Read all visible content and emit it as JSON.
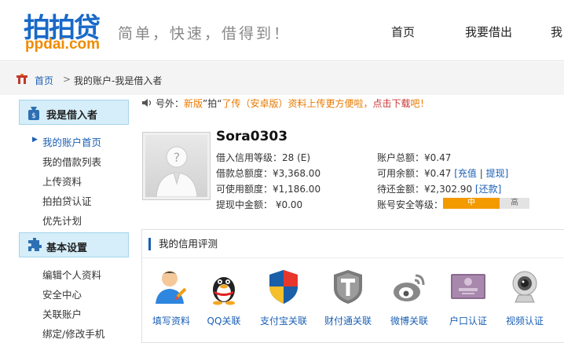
{
  "header": {
    "logo_cn": "拍拍贷",
    "logo_en": "ppdai.com",
    "slogan": "简单，快速，借得到！",
    "nav": [
      "首页",
      "我要借出",
      "我"
    ]
  },
  "breadcrumb": {
    "home": "首页",
    "separator": ">",
    "current": "我的账户-我是借入者"
  },
  "sidebar": {
    "section1": {
      "title": "我是借入者",
      "items": [
        "我的账户首页",
        "我的借款列表",
        "上传资料",
        "拍拍贷认证",
        "优先计划"
      ],
      "active_index": 0
    },
    "section2": {
      "title": "基本设置",
      "items": [
        "编辑个人资料",
        "安全中心",
        "关联账户",
        "绑定/修改手机"
      ]
    }
  },
  "notice": {
    "prefix": "号外：",
    "part1": "新版",
    "part2": "”拍“",
    "part3": "了传（安卓版）",
    "part4": "资料上传更方便啦，",
    "link": "点击下载",
    "suffix": "吧！"
  },
  "profile": {
    "username": "Sora0303",
    "credit_level": "借入信用等级：28 (E)",
    "total_credit": "借款总额度：¥3,368.00",
    "available_credit": "可使用额度：¥1,186.00",
    "withdraw_pending": "提现中金额：  ¥0.00",
    "account_total": "账户总额：¥0.47",
    "available_balance": "可用余额：¥0.47",
    "recharge_link": "[充值",
    "link_sep": "|",
    "withdraw_link": "提现]",
    "to_repay": "待还金额：¥2,302.90",
    "repay_link": "[还款]",
    "security_label": "账号安全等级：",
    "security_mid": "中",
    "security_high": "高",
    "security_level": 0.66
  },
  "credit": {
    "title": "我的信用评测",
    "items": [
      {
        "label": "填写资料",
        "icon": "user-edit-icon"
      },
      {
        "label": "QQ关联",
        "icon": "qq-penguin-icon"
      },
      {
        "label": "支付宝关联",
        "icon": "alipay-shield-icon"
      },
      {
        "label": "财付通关联",
        "icon": "tenpay-icon"
      },
      {
        "label": "微博关联",
        "icon": "weibo-icon"
      },
      {
        "label": "户口认证",
        "icon": "hukou-book-icon"
      },
      {
        "label": "视频认证",
        "icon": "webcam-icon"
      }
    ]
  },
  "colors": {
    "brand_blue": "#1869c8",
    "brand_orange": "#f08a00",
    "link_blue": "#1a5fb4",
    "sidebar_head": "#d5eef9",
    "security_mid": "#f39a00"
  }
}
